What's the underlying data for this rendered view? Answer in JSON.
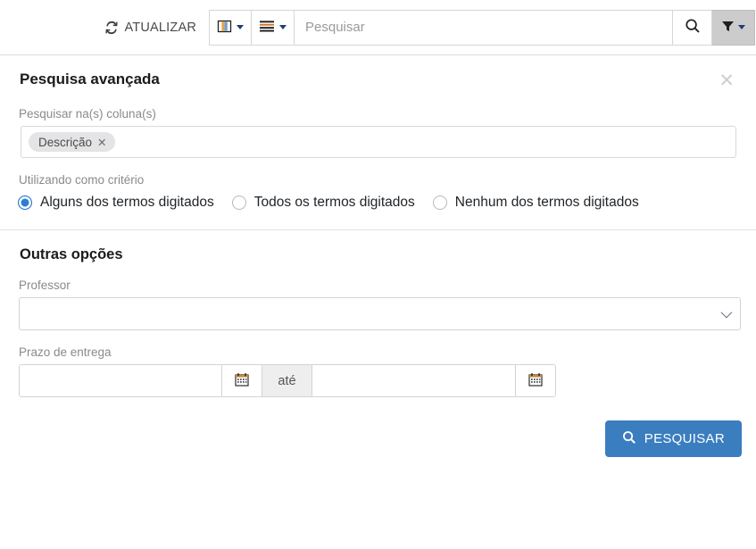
{
  "toolbar": {
    "refresh_label": "ATUALIZAR",
    "refresh_icon": "refresh-icon",
    "columns_icon": "columns-icon",
    "list_icon": "list-lines-icon",
    "search_placeholder": "Pesquisar",
    "search_value": "",
    "search_icon": "magnifier-icon",
    "filter_icon": "funnel-icon",
    "filter_active": true
  },
  "panel": {
    "title": "Pesquisa avançada",
    "close_icon": "close-icon",
    "columns_field": {
      "label": "Pesquisar na(s) coluna(s)",
      "tags": [
        {
          "label": "Descrição",
          "remove_icon": "tag-remove-icon"
        }
      ]
    },
    "criteria_field": {
      "label": "Utilizando como critério",
      "options": [
        {
          "label": "Alguns dos termos digitados",
          "selected": true
        },
        {
          "label": "Todos os termos digitados",
          "selected": false
        },
        {
          "label": "Nenhum dos termos digitados",
          "selected": false
        }
      ]
    }
  },
  "other_options": {
    "title": "Outras opções",
    "professor": {
      "label": "Professor",
      "value": "",
      "chevron_icon": "chevron-down-icon"
    },
    "deadline": {
      "label": "Prazo de entrega",
      "start_value": "",
      "end_value": "",
      "separator_label": "até",
      "calendar_icon": "calendar-icon"
    }
  },
  "footer": {
    "submit_label": "PESQUISAR",
    "submit_icon": "magnifier-icon"
  },
  "colors": {
    "accent_blue": "#3a7ebf",
    "radio_blue": "#2a7fd4",
    "filter_active_bg": "#cccccc",
    "tag_bg": "#e4e4e6",
    "muted_text": "#8a8a8a"
  }
}
